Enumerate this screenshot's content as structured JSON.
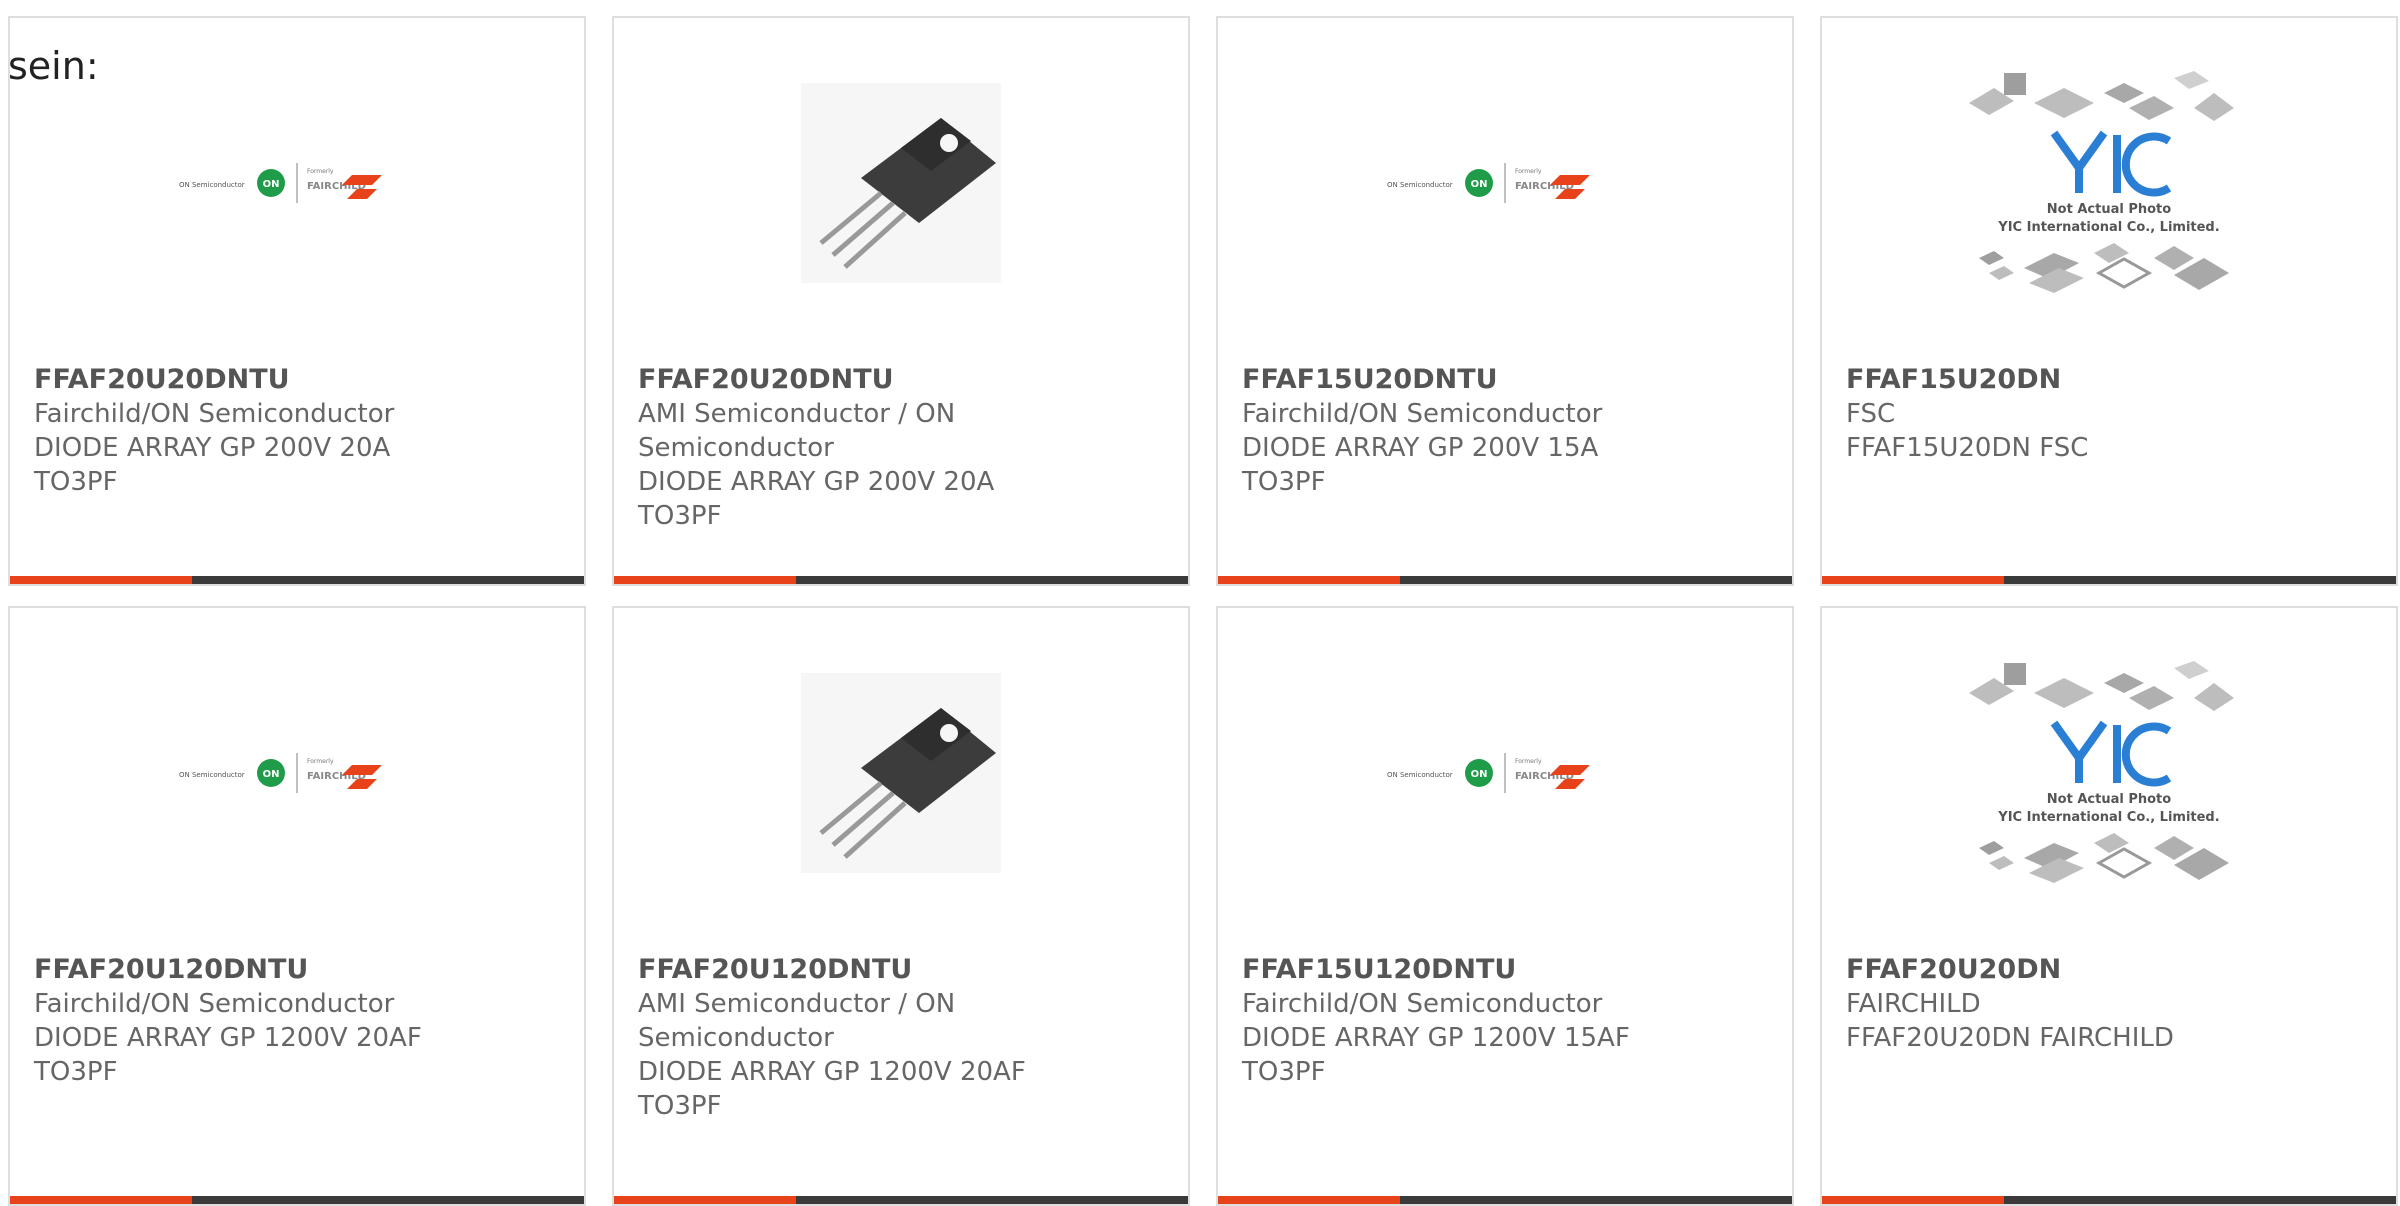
{
  "heading": "sein:",
  "accent_color": "#e8421a",
  "bar_color": "#3a3a3a",
  "cards": [
    {
      "part": "FFAF20U20DNTU",
      "lines": [
        "Fairchild/ON Semiconductor",
        "DIODE ARRAY GP 200V 20A",
        "TO3PF"
      ],
      "image": "onsemi-fairchild-logo"
    },
    {
      "part": "FFAF20U20DNTU",
      "lines": [
        "AMI Semiconductor / ON",
        "Semiconductor",
        "DIODE ARRAY GP 200V 20A",
        "TO3PF"
      ],
      "image": "to220-package-photo"
    },
    {
      "part": "FFAF15U20DNTU",
      "lines": [
        "Fairchild/ON Semiconductor",
        "DIODE ARRAY GP 200V 15A",
        "TO3PF"
      ],
      "image": "onsemi-fairchild-logo"
    },
    {
      "part": "FFAF15U20DN",
      "lines": [
        "FSC",
        "FFAF15U20DN FSC"
      ],
      "image": "yic-placeholder"
    },
    {
      "part": "FFAF20U120DNTU",
      "lines": [
        "Fairchild/ON Semiconductor",
        "DIODE ARRAY GP 1200V 20AF",
        "TO3PF"
      ],
      "image": "onsemi-fairchild-logo"
    },
    {
      "part": "FFAF20U120DNTU",
      "lines": [
        "AMI Semiconductor / ON",
        "Semiconductor",
        "DIODE ARRAY GP 1200V 20AF",
        "TO3PF"
      ],
      "image": "to220-package-photo"
    },
    {
      "part": "FFAF15U120DNTU",
      "lines": [
        "Fairchild/ON Semiconductor",
        "DIODE ARRAY GP 1200V 15AF",
        "TO3PF"
      ],
      "image": "onsemi-fairchild-logo"
    },
    {
      "part": "FFAF20U20DN",
      "lines": [
        "FAIRCHILD",
        "FFAF20U20DN FAIRCHILD"
      ],
      "image": "yic-placeholder"
    }
  ],
  "logo": {
    "on_semi": "ON Semiconductor",
    "on_badge": "ON",
    "formerly": "Formerly",
    "fairchild": "FAIRCHILD"
  },
  "yic": {
    "mark": "YIC",
    "line1": "Not Actual Photo",
    "line2": "YIC International Co., Limited."
  }
}
